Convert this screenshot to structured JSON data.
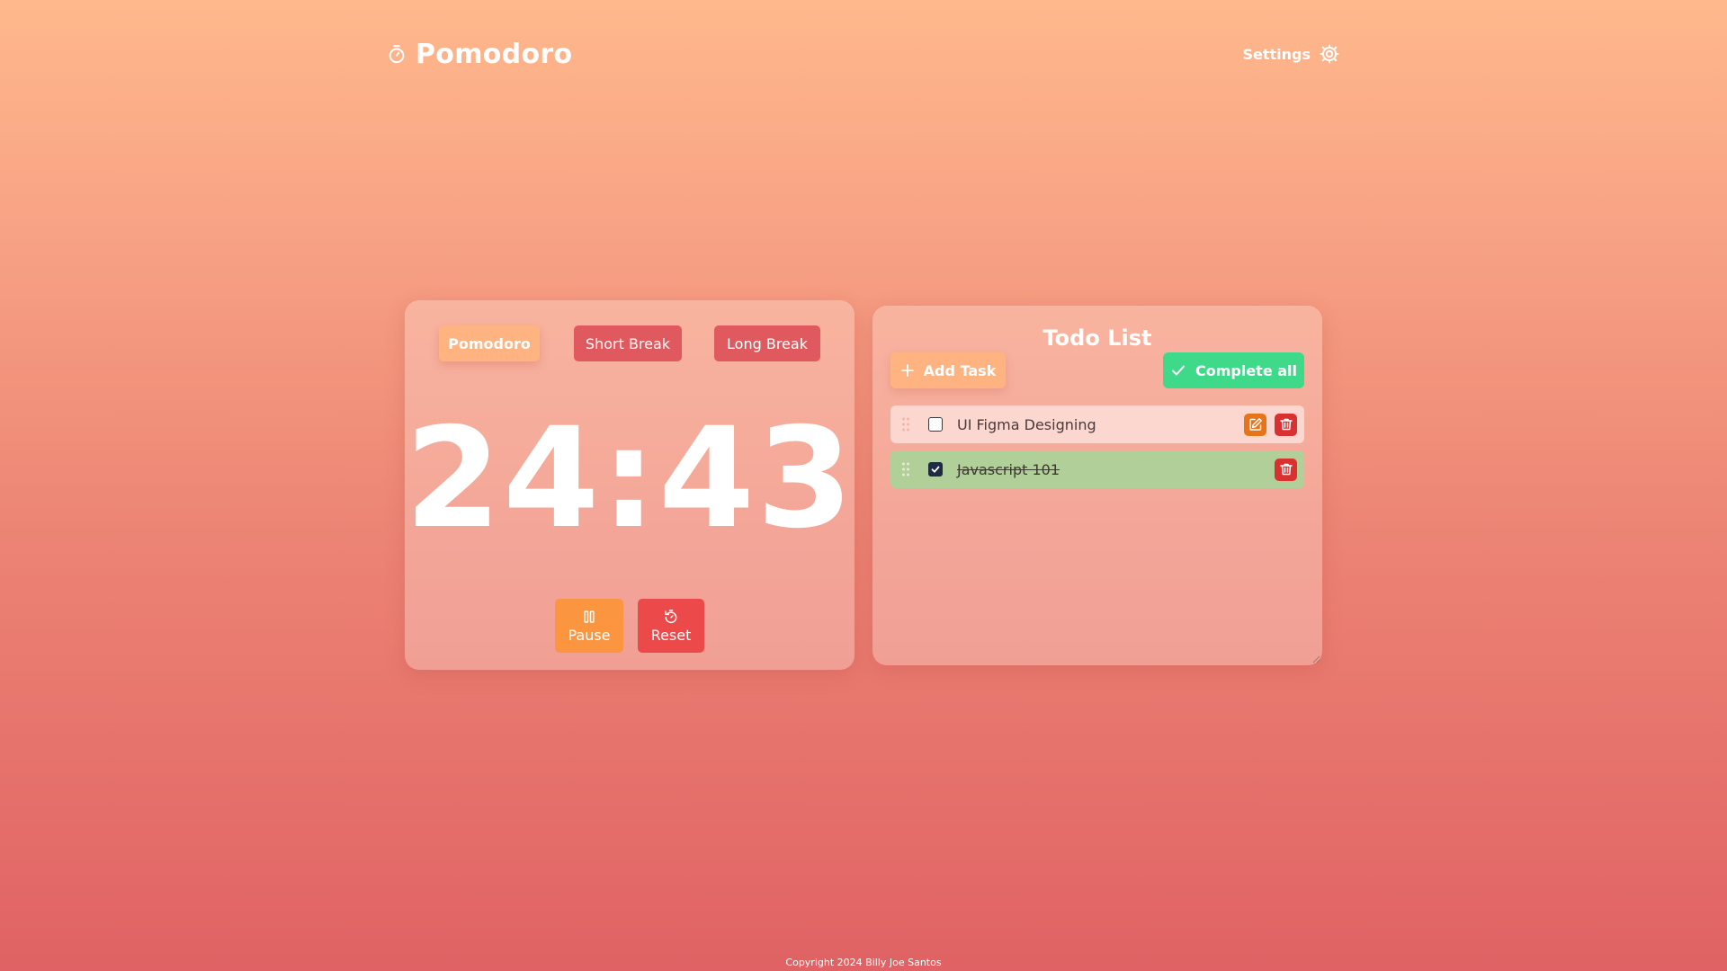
{
  "header": {
    "brand_icon": "stopwatch-icon",
    "brand_title": "Pomodoro",
    "settings_label": "Settings",
    "settings_icon": "gear-icon"
  },
  "timer": {
    "modes": [
      {
        "label": "Pomodoro",
        "active": true
      },
      {
        "label": "Short Break",
        "active": false
      },
      {
        "label": "Long Break",
        "active": false
      }
    ],
    "time": "24:43",
    "pause_label": "Pause",
    "pause_icon": "pause-icon",
    "reset_label": "Reset",
    "reset_icon": "reset-timer-icon"
  },
  "todo": {
    "title": "Todo List",
    "add_task_label": "Add Task",
    "complete_all_label": "Complete all",
    "tasks": [
      {
        "text": "UI Figma Designing",
        "completed": false
      },
      {
        "text": "Javascript 101",
        "completed": true
      }
    ]
  },
  "footer": {
    "copyright": "Copyright 2024 Billy Joe Santos"
  },
  "colors": {
    "accent_orange": "#ffb380",
    "tab_red": "#e0595e",
    "pause_orange": "#fb953f",
    "reset_red": "#ec4a4a",
    "complete_green": "#3fd98a",
    "done_row_green": "#b0cf99",
    "edit_orange": "#e8741a",
    "delete_red": "#d93030"
  }
}
